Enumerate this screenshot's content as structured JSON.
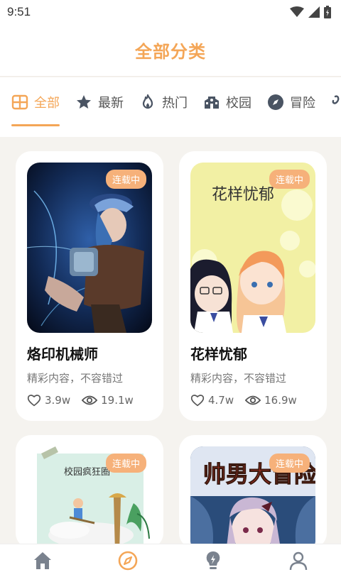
{
  "status": {
    "time": "9:51"
  },
  "header": {
    "title": "全部分类"
  },
  "tabs": [
    {
      "label": "全部",
      "icon": "grid-icon",
      "active": true
    },
    {
      "label": "最新",
      "icon": "star-icon",
      "active": false
    },
    {
      "label": "热门",
      "icon": "flame-icon",
      "active": false
    },
    {
      "label": "校园",
      "icon": "school-icon",
      "active": false
    },
    {
      "label": "冒险",
      "icon": "compass-icon",
      "active": false
    }
  ],
  "cards": [
    {
      "badge": "连载中",
      "title": "烙印机械师",
      "desc": "精彩内容，不容错过",
      "likes": "3.9w",
      "views": "19.1w",
      "cover_text": ""
    },
    {
      "badge": "连载中",
      "title": "花样忧郁",
      "desc": "精彩内容，不容错过",
      "likes": "4.7w",
      "views": "16.9w",
      "cover_text": "花样忧郁"
    },
    {
      "badge": "连载中",
      "cover_text": "校园疯狂圈"
    },
    {
      "badge": "连载中",
      "cover_text": "帅男大冒险"
    }
  ],
  "colors": {
    "accent": "#f4a657",
    "badge": "#f6b17a",
    "background": "#f5f3ef"
  },
  "bottom_nav": [
    {
      "icon": "home-icon",
      "active": false
    },
    {
      "icon": "compass-icon",
      "active": true
    },
    {
      "icon": "lightbulb-icon",
      "active": false
    },
    {
      "icon": "profile-icon",
      "active": false
    }
  ]
}
